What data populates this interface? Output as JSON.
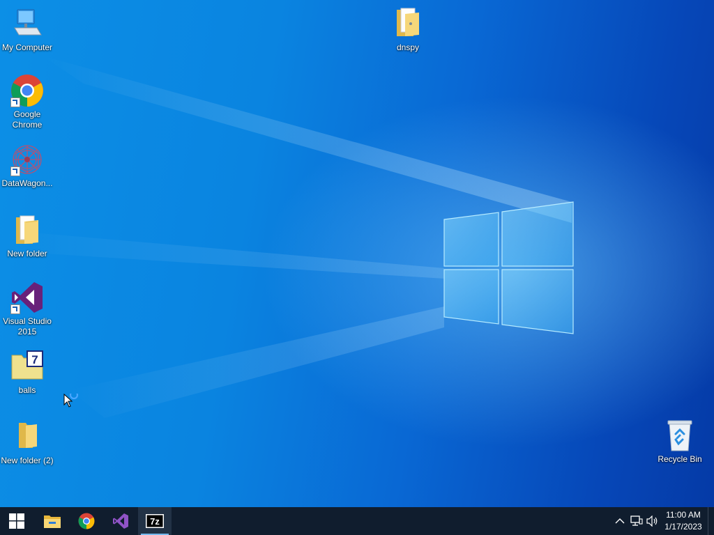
{
  "desktop": {
    "icons": [
      {
        "id": "my-computer",
        "label": "My Computer",
        "icon": "computer-icon"
      },
      {
        "id": "google-chrome",
        "label": "Google Chrome",
        "icon": "chrome-icon",
        "shortcut": true
      },
      {
        "id": "datawagon",
        "label": "DataWagon...",
        "icon": "datawagon-icon",
        "shortcut": true
      },
      {
        "id": "new-folder",
        "label": "New folder",
        "icon": "folder-icon"
      },
      {
        "id": "visual-studio",
        "label": "Visual Studio 2015",
        "icon": "visual-studio-icon",
        "shortcut": true
      },
      {
        "id": "balls",
        "label": "balls",
        "icon": "7zip-archive-icon"
      },
      {
        "id": "new-folder-2",
        "label": "New folder (2)",
        "icon": "folder-icon"
      },
      {
        "id": "dnspy",
        "label": "dnspy",
        "icon": "folder-icon"
      },
      {
        "id": "recycle-bin",
        "label": "Recycle Bin",
        "icon": "recycle-bin-icon"
      }
    ]
  },
  "taskbar": {
    "start": {
      "icon": "windows-start-icon"
    },
    "pinned": [
      {
        "id": "file-explorer",
        "icon": "file-explorer-icon"
      },
      {
        "id": "chrome",
        "icon": "chrome-icon"
      },
      {
        "id": "visual-studio",
        "icon": "visual-studio-icon"
      },
      {
        "id": "7zip",
        "icon": "7zip-icon",
        "active": true
      }
    ],
    "tray": {
      "icons": [
        "chevron-up-icon",
        "network-icon",
        "volume-icon"
      ],
      "time": "11:00 AM",
      "date": "1/17/2023"
    }
  },
  "colors": {
    "taskbar": "#101d2e",
    "desktop_accent": "#0a84e0"
  }
}
